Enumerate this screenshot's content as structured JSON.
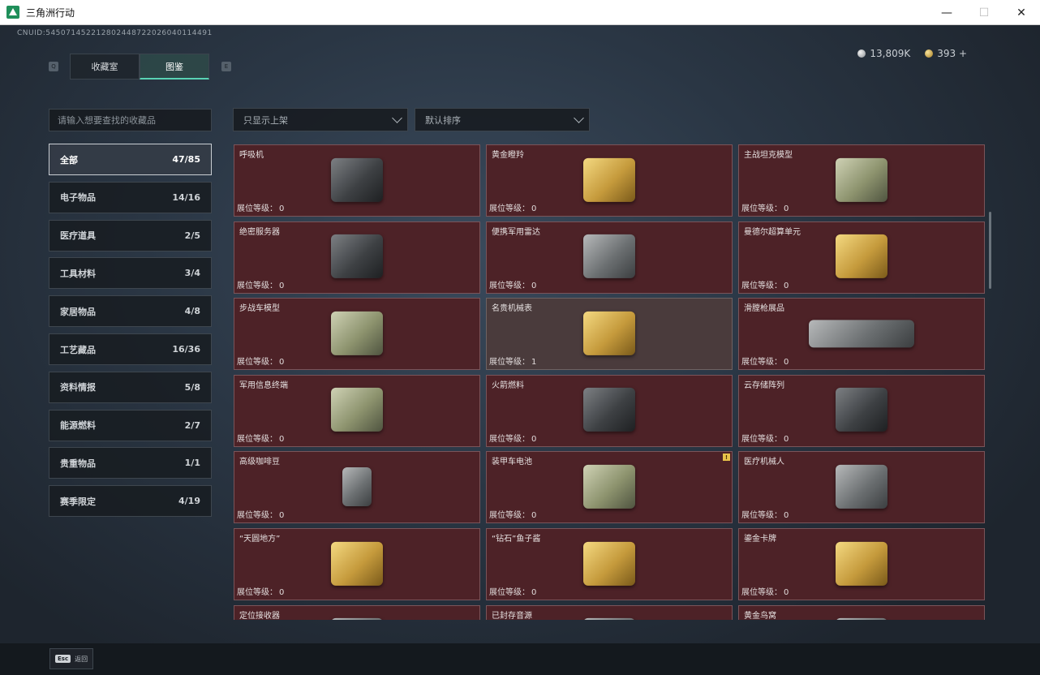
{
  "window": {
    "title": "三角洲行动"
  },
  "header": {
    "uid": "CNUID:545071452212802448722026040114491",
    "currency": [
      {
        "name": "silver-coin-icon",
        "value": "13,809K"
      },
      {
        "name": "gold-coin-icon",
        "value": "393 +"
      }
    ]
  },
  "tabs": [
    {
      "label": "收藏室",
      "active": false
    },
    {
      "label": "图鉴",
      "active": true
    }
  ],
  "tab_keys": {
    "left": "Q",
    "right": "E"
  },
  "search": {
    "placeholder": "请输入想要查找的收藏品"
  },
  "filters": {
    "display": "只显示上架",
    "sort": "默认排序"
  },
  "categories": [
    {
      "label": "全部",
      "count": "47/85",
      "active": true
    },
    {
      "label": "电子物品",
      "count": "14/16"
    },
    {
      "label": "医疗道具",
      "count": "2/5"
    },
    {
      "label": "工具材料",
      "count": "3/4"
    },
    {
      "label": "家居物品",
      "count": "4/8"
    },
    {
      "label": "工艺藏品",
      "count": "16/36"
    },
    {
      "label": "资料情报",
      "count": "5/8"
    },
    {
      "label": "能源燃料",
      "count": "2/7"
    },
    {
      "label": "贵重物品",
      "count": "1/1"
    },
    {
      "label": "赛季限定",
      "count": "4/19"
    }
  ],
  "level_label": "展位等级：",
  "items": [
    {
      "name": "呼吸机",
      "level": "0",
      "art": "dark"
    },
    {
      "name": "黄金瞪羚",
      "level": "0",
      "art": "gold"
    },
    {
      "name": "主战坦克模型",
      "level": "0",
      "art": "green"
    },
    {
      "name": "绝密服务器",
      "level": "0",
      "art": "dark"
    },
    {
      "name": "便携军用雷达",
      "level": "0",
      "art": ""
    },
    {
      "name": "曼德尔超算单元",
      "level": "0",
      "art": "gold"
    },
    {
      "name": "步战车模型",
      "level": "0",
      "art": "green"
    },
    {
      "name": "名贵机械表",
      "level": "1",
      "art": "gold",
      "unlocked": true
    },
    {
      "name": "滑膛枪展品",
      "level": "0",
      "art": "wide"
    },
    {
      "name": "军用信息终端",
      "level": "0",
      "art": "green"
    },
    {
      "name": "火箭燃料",
      "level": "0",
      "art": "dark"
    },
    {
      "name": "云存储阵列",
      "level": "0",
      "art": "dark"
    },
    {
      "name": "高级咖啡豆",
      "level": "0",
      "art": "small"
    },
    {
      "name": "装甲车电池",
      "level": "0",
      "art": "green",
      "badge": "!"
    },
    {
      "name": "医疗机械人",
      "level": "0",
      "art": ""
    },
    {
      "name": "“天圆地方”",
      "level": "0",
      "art": "gold"
    },
    {
      "name": "“钻石”鱼子酱",
      "level": "0",
      "art": "gold"
    },
    {
      "name": "鎏金卡牌",
      "level": "0",
      "art": "gold"
    },
    {
      "name": "定位接收器",
      "level": "",
      "art": ""
    },
    {
      "name": "已封存音源",
      "level": "",
      "art": ""
    },
    {
      "name": "黄金鸟窝",
      "level": "",
      "art": ""
    }
  ],
  "footer": {
    "esc_key": "Esc",
    "esc_label": "返回"
  }
}
